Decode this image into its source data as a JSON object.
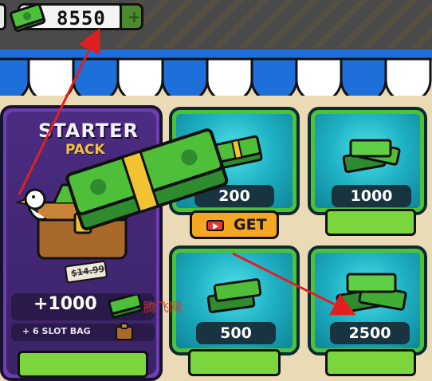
{
  "topbar": {
    "currency": "8550",
    "plus_label": "+"
  },
  "starter_pack": {
    "title": "STARTER",
    "subtitle": "PACK",
    "old_price": "$14.99",
    "bonus_cash": "+1000",
    "bonus_item": "+ 6 SLOT BAG"
  },
  "offers": [
    {
      "amount": "200",
      "button": "GET"
    },
    {
      "amount": "1000"
    },
    {
      "amount": "500"
    },
    {
      "amount": "2500"
    }
  ],
  "watermark": "腾飞网",
  "colors": {
    "topbar": "#4a4a4a",
    "awning_blue": "#1e6fd9",
    "card_teal": "#1aa3b8",
    "card_border_green": "#4cc13a",
    "button_green": "#7bd63e",
    "get_orange": "#f5a623",
    "starter_purple": "#6b3fb0",
    "annotation_red": "#e02020"
  },
  "icons": [
    "cash-stack-icon",
    "play-video-icon",
    "seagull-mascot",
    "treasure-chest-icon",
    "slot-bag-icon",
    "sparkle-icon"
  ]
}
